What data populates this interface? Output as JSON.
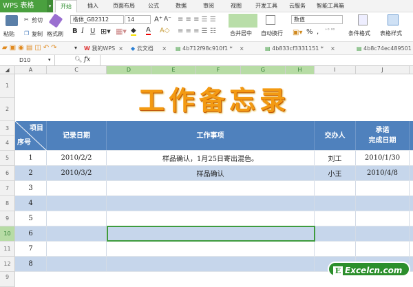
{
  "app": {
    "logo": "WPS 表格"
  },
  "tabs": [
    "开始",
    "插入",
    "页面布局",
    "公式",
    "数据",
    "审阅",
    "视图",
    "开发工具",
    "云服务",
    "智能工具箱"
  ],
  "ribbon": {
    "paste": "粘贴",
    "cut": "剪切",
    "copy": "复制",
    "format_painter": "格式刷",
    "font": "楷体_GB2312",
    "size": "14",
    "bold": "B",
    "italic": "I",
    "underline": "U",
    "merge": "合并居中",
    "wrap": "自动换行",
    "number_format": "数值",
    "percent": "%",
    "comma": ",",
    "cond_format": "条件格式",
    "table_style": "表格样式"
  },
  "doc_tabs": [
    "我的WPS",
    "云文档",
    "4b712f98c910f1 *",
    "4b833cf3331151 *",
    "4b8c74ec489501 *"
  ],
  "formula_bar": {
    "name_box": "D10",
    "fx": "fx",
    "value": ""
  },
  "columns": [
    "A",
    "C",
    "D",
    "E",
    "F",
    "G",
    "H",
    "I",
    "J"
  ],
  "rows": [
    "1",
    "2",
    "3",
    "4",
    "5",
    "6",
    "7",
    "8",
    "9",
    "10",
    "11",
    "12",
    "9"
  ],
  "sheet": {
    "title": "工作备忘录",
    "header": {
      "diag_top": "项目",
      "diag_bottom": "序号",
      "date": "记录日期",
      "item": "工作事项",
      "person": "交办人",
      "due": "承诺\n完成日期"
    },
    "records": [
      {
        "no": "1",
        "date": "2010/2/2",
        "item": "样品确认，1月25日寄出混色。",
        "person": "刘工",
        "due": "2010/1/30"
      },
      {
        "no": "2",
        "date": "2010/3/2",
        "item": "样品确认",
        "person": "小王",
        "due": "2010/4/8"
      },
      {
        "no": "3"
      },
      {
        "no": "4"
      },
      {
        "no": "5"
      },
      {
        "no": "6"
      },
      {
        "no": "7"
      },
      {
        "no": "8"
      }
    ]
  },
  "watermark": "Excelcn.com",
  "colors": {
    "header": "#4f81bd",
    "band": "#c6d6eb",
    "accent": "#4aa03f"
  }
}
